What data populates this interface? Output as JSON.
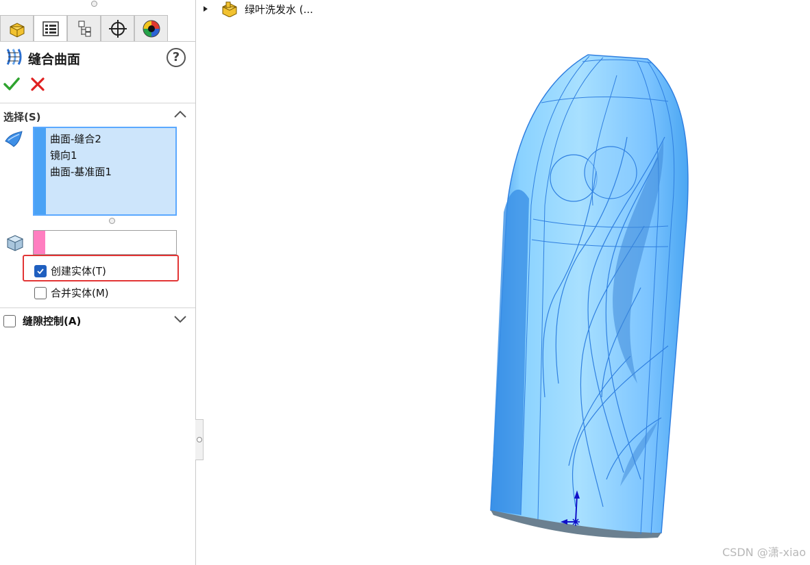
{
  "tabs": [
    {
      "icon": "feature-manager-icon",
      "active": false
    },
    {
      "icon": "property-manager-icon",
      "active": true
    },
    {
      "icon": "configuration-manager-icon",
      "active": false
    },
    {
      "icon": "dimxpert-icon",
      "active": false
    },
    {
      "icon": "display-manager-icon",
      "active": false
    }
  ],
  "property_manager": {
    "title": "缝合曲面",
    "help_label": "?"
  },
  "selection": {
    "title": "选择(S)",
    "items": [
      "曲面-缝合2",
      "镜向1",
      "曲面-基准面1"
    ]
  },
  "options": {
    "create_solid": {
      "label": "创建实体(T)",
      "checked": true
    },
    "merge_entities": {
      "label": "合并实体(M)",
      "checked": false
    }
  },
  "gap_control": {
    "title": "缝隙控制(A)",
    "checked": false
  },
  "feature_tree": {
    "part_name": "绿叶洗发水 (..."
  },
  "watermark": "CSDN @潇-xiao",
  "colors": {
    "selection_bg": "#cde5fb",
    "selection_bar": "#4aa2f5",
    "body_bar": "#ff7ec0",
    "highlight_border": "#e23434",
    "model_fill": "#7cc4ff",
    "model_edge": "#2f7fe0"
  }
}
